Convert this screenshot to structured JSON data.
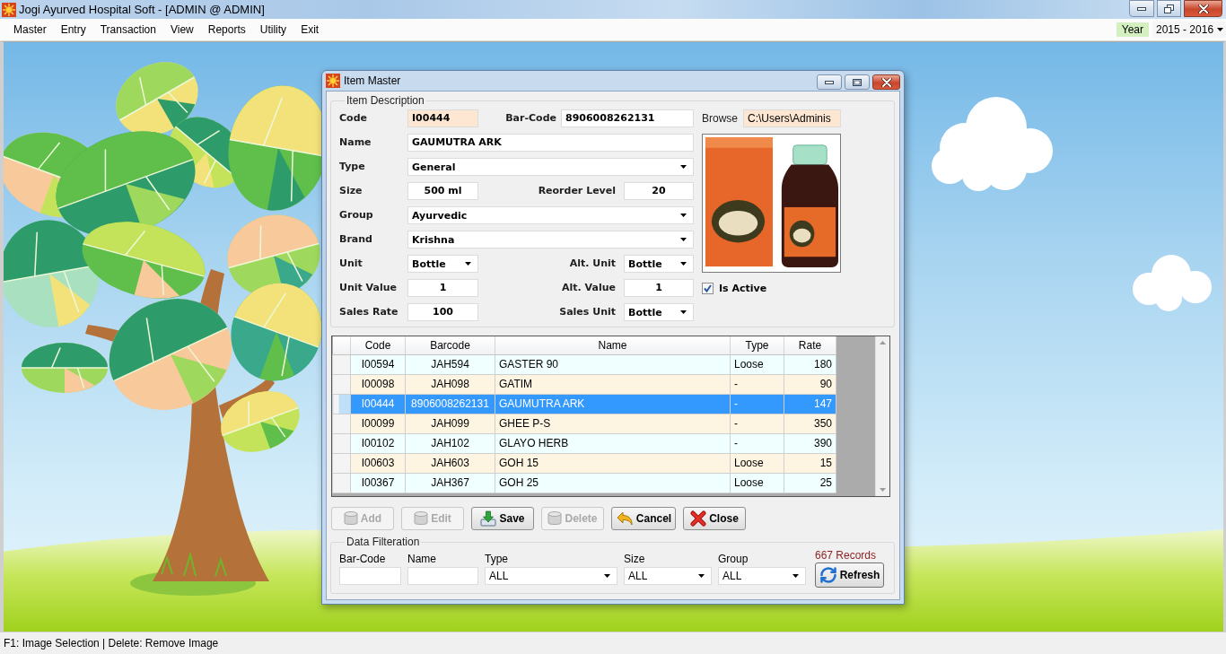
{
  "window": {
    "title": "Jogi Ayurved Hospital Soft - [ADMIN @ ADMIN]"
  },
  "menu": [
    "Master",
    "Entry",
    "Transaction",
    "View",
    "Reports",
    "Utility",
    "Exit"
  ],
  "year": {
    "label": "Year",
    "value": "2015 - 2016"
  },
  "dialog": {
    "title": "Item Master",
    "item_description": {
      "title": "Item Description",
      "code": {
        "label": "Code",
        "kind": "text",
        "value": "I00444",
        "readonly": true
      },
      "bar_code": {
        "label": "Bar-Code",
        "kind": "text",
        "value": "8906008262131",
        "readonly": false
      },
      "browse": {
        "label": "Browse",
        "kind": "text",
        "value": "C:\\Users\\Adminis",
        "readonly": true
      },
      "name": {
        "label": "Name",
        "kind": "text",
        "value": "GAUMUTRA ARK",
        "readonly": false
      },
      "type": {
        "label": "Type",
        "kind": "dropdown",
        "value": "General"
      },
      "size": {
        "label": "Size",
        "kind": "text",
        "value": "500 ml",
        "readonly": false
      },
      "reorder_level": {
        "label": "Reorder Level",
        "kind": "text",
        "value": "20",
        "readonly": false
      },
      "group": {
        "label": "Group",
        "kind": "dropdown",
        "value": "Ayurvedic"
      },
      "brand": {
        "label": "Brand",
        "kind": "dropdown",
        "value": "Krishna"
      },
      "unit": {
        "label": "Unit",
        "kind": "dropdown",
        "value": "Bottle"
      },
      "alt_unit": {
        "label": "Alt. Unit",
        "kind": "dropdown",
        "value": "Bottle"
      },
      "unit_value": {
        "label": "Unit Value",
        "kind": "text",
        "value": "1",
        "readonly": false
      },
      "alt_value": {
        "label": "Alt. Value",
        "kind": "text",
        "value": "1",
        "readonly": false
      },
      "is_active": {
        "label": "Is Active",
        "checked": true
      },
      "sales_rate": {
        "label": "Sales Rate",
        "kind": "text",
        "value": "100",
        "readonly": false
      },
      "sales_unit": {
        "label": "Sales Unit",
        "kind": "dropdown",
        "value": "Bottle"
      }
    },
    "table": {
      "columns": [
        "Code",
        "Barcode",
        "Name",
        "Type",
        "Rate"
      ],
      "rows": [
        {
          "cells": [
            "I00594",
            "JAH594",
            "GASTER 90",
            "Loose",
            "180"
          ],
          "selected": false
        },
        {
          "cells": [
            "I00098",
            "JAH098",
            "GATIM",
            "-",
            "90"
          ],
          "selected": false
        },
        {
          "cells": [
            "I00444",
            "8906008262131",
            "GAUMUTRA ARK",
            "-",
            "147"
          ],
          "selected": true
        },
        {
          "cells": [
            "I00099",
            "JAH099",
            "GHEE P-S",
            "-",
            "350"
          ],
          "selected": false
        },
        {
          "cells": [
            "I00102",
            "JAH102",
            "GLAYO HERB",
            "-",
            "390"
          ],
          "selected": false
        },
        {
          "cells": [
            "I00603",
            "JAH603",
            "GOH 15",
            "Loose",
            "15"
          ],
          "selected": false
        },
        {
          "cells": [
            "I00367",
            "JAH367",
            "GOH 25",
            "Loose",
            "25"
          ],
          "selected": false
        }
      ]
    },
    "buttons": [
      {
        "label": "Add",
        "kind": "add",
        "disabled": true
      },
      {
        "label": "Edit",
        "kind": "edit",
        "disabled": true
      },
      {
        "label": "Save",
        "kind": "save",
        "disabled": false
      },
      {
        "label": "Delete",
        "kind": "delete",
        "disabled": true
      },
      {
        "label": "Cancel",
        "kind": "cancel",
        "disabled": false
      },
      {
        "label": "Close",
        "kind": "close",
        "disabled": false
      }
    ],
    "filter": {
      "title": "Data Filteration",
      "records": "667 Records",
      "fields": [
        {
          "label": "Bar-Code",
          "kind": "text"
        },
        {
          "label": "Name",
          "kind": "text"
        },
        {
          "label": "Type",
          "kind": "dropdown",
          "value": "ALL"
        },
        {
          "label": "Size",
          "kind": "dropdown",
          "value": "ALL"
        },
        {
          "label": "Group",
          "kind": "dropdown",
          "value": "ALL"
        }
      ],
      "refresh_button": "Refresh"
    }
  },
  "status_bar": "F1: Image Selection | Delete: Remove Image"
}
